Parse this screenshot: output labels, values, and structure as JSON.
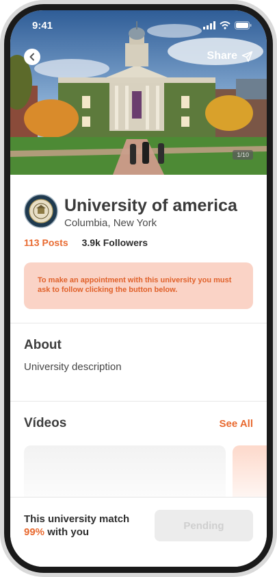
{
  "status_bar": {
    "time": "9:41"
  },
  "header": {
    "share_label": "Share",
    "photo_counter": "1/10"
  },
  "university": {
    "name": "University of america",
    "location": "Columbia, New York",
    "posts": "113 Posts",
    "followers": "3.9k Followers"
  },
  "notice": {
    "text": "To make an appointment with this university you must ask to follow clicking the button below."
  },
  "about": {
    "title": "About",
    "description": "University description"
  },
  "videos": {
    "title": "Vídeos",
    "see_all": "See All"
  },
  "match": {
    "prefix": "This university match",
    "percent": "99%",
    "suffix": "with you"
  },
  "action": {
    "button_label": "Pending"
  },
  "colors": {
    "accent": "#e8692f",
    "notice_bg": "#fad3c6",
    "button_bg": "#ececec"
  }
}
